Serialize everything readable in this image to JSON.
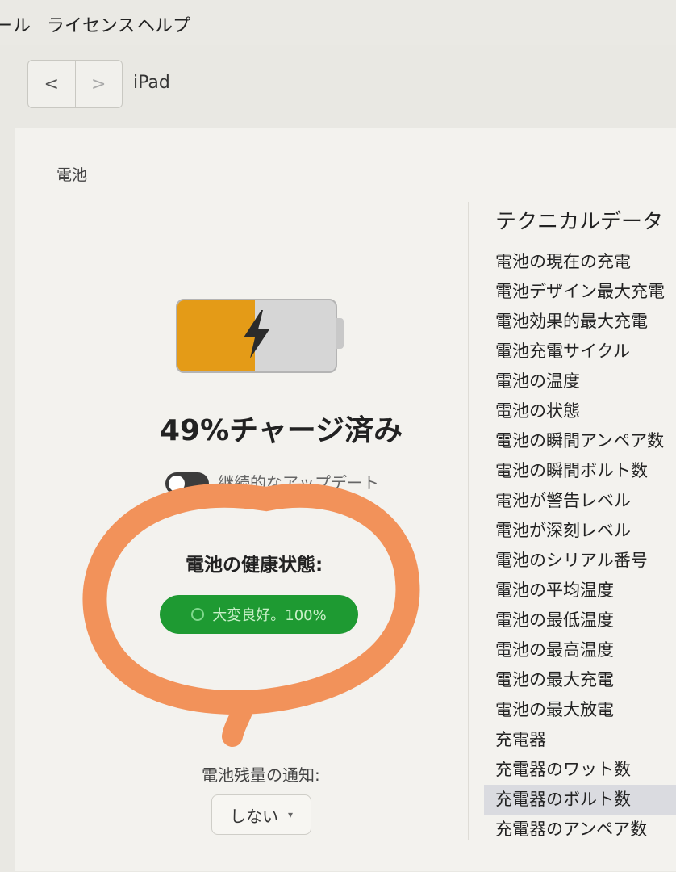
{
  "menubar": {
    "items": [
      "ール",
      "ライセンス",
      "ヘルプ"
    ]
  },
  "toolbar": {
    "back": "<",
    "forward": ">",
    "device": "iPad"
  },
  "section": {
    "title": "電池"
  },
  "battery": {
    "level_fraction": 0.49,
    "charge_text": "49%チャージ済み",
    "fill_color": "#e49b17",
    "continuous_update_label": "継続的なアップデート",
    "continuous_update_on": true
  },
  "health": {
    "label": "電池の健康状態:",
    "status": "大変良好。100%",
    "color": "#1e9a32"
  },
  "notify": {
    "label": "電池残量の通知:",
    "value": "しない"
  },
  "technical": {
    "title": "テクニカルデータ",
    "items": [
      "電池の現在の充電",
      "電池デザイン最大充電",
      "電池効果的最大充電",
      "電池充電サイクル",
      "電池の温度",
      "電池の状態",
      "電池の瞬間アンペア数",
      "電池の瞬間ボルト数",
      "電池が警告レベル",
      "電池が深刻レベル",
      "電池のシリアル番号",
      "電池の平均温度",
      "電池の最低温度",
      "電池の最高温度",
      "電池の最大充電",
      "電池の最大放電",
      "充電器",
      "充電器のワット数",
      "充電器のボルト数",
      "充電器のアンペア数"
    ],
    "selected_index": 18
  },
  "annotation_color": "#f2925a"
}
